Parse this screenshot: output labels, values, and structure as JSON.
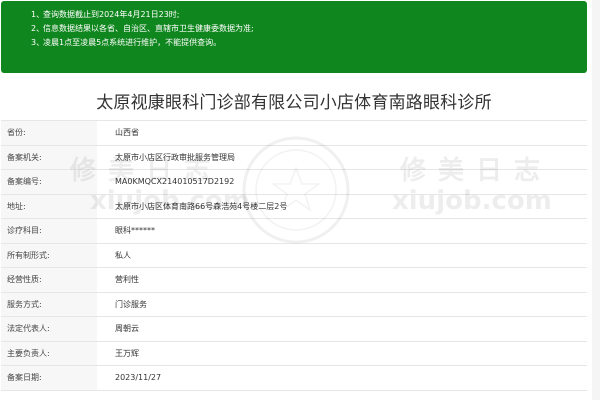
{
  "notice": {
    "lines": [
      {
        "num": "1、",
        "text": "查询数据截止到2024年4月21日23时;"
      },
      {
        "num": "2、",
        "text": "信息数据结果以各省、自治区、直辖市卫生健康委数据为准;"
      },
      {
        "num": "3、",
        "text": "凌晨1点至凌晨5点系统进行维护，不能提供查询。"
      }
    ]
  },
  "title": "太原视康眼科门诊部有限公司小店体育南路眼科诊所",
  "rows": [
    {
      "label": "省份:",
      "value": "山西省"
    },
    {
      "label": "备案机关:",
      "value": "太原市小店区行政审批服务管理局"
    },
    {
      "label": "备案编号:",
      "value": "MA0KMQCX214010517D2192"
    },
    {
      "label": "地址:",
      "value": "太原市小店区体育南路66号森浩苑4号楼二层2号"
    },
    {
      "label": "诊疗科目:",
      "value": "眼科******"
    },
    {
      "label": "所有制形式:",
      "value": "私人"
    },
    {
      "label": "经营性质:",
      "value": "营利性"
    },
    {
      "label": "服务方式:",
      "value": "门诊服务"
    },
    {
      "label": "法定代表人:",
      "value": "周朝云"
    },
    {
      "label": "主要负责人:",
      "value": "王万辉"
    },
    {
      "label": "备案日期:",
      "value": "2023/11/27"
    }
  ],
  "watermark": {
    "text_cn": "修美日志",
    "text_en": "xiujob.com"
  }
}
